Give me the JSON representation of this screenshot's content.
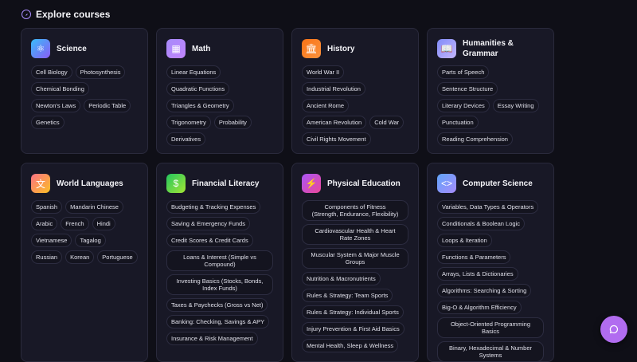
{
  "header": {
    "title": "Explore courses",
    "icon": "compass-icon"
  },
  "courses": [
    {
      "title": "Science",
      "icon": "atom-icon",
      "topics": [
        "Cell Biology",
        "Photosynthesis",
        "Chemical Bonding",
        "Newton's Laws",
        "Periodic Table",
        "Genetics"
      ]
    },
    {
      "title": "Math",
      "icon": "calculator-icon",
      "topics": [
        "Linear Equations",
        "Quadratic Functions",
        "Triangles & Geometry",
        "Trigonometry",
        "Probability",
        "Derivatives"
      ]
    },
    {
      "title": "History",
      "icon": "landmark-icon",
      "topics": [
        "World War II",
        "Industrial Revolution",
        "Ancient Rome",
        "American Revolution",
        "Cold War",
        "Civil Rights Movement"
      ]
    },
    {
      "title": "Humanities & Grammar",
      "icon": "book-icon",
      "topics": [
        "Parts of Speech",
        "Sentence Structure",
        "Literary Devices",
        "Essay Writing",
        "Punctuation",
        "Reading Comprehension"
      ]
    },
    {
      "title": "World Languages",
      "icon": "translate-icon",
      "topics": [
        "Spanish",
        "Mandarin Chinese",
        "Arabic",
        "French",
        "Hindi",
        "Vietnamese",
        "Tagalog",
        "Russian",
        "Korean",
        "Portuguese"
      ]
    },
    {
      "title": "Financial Literacy",
      "icon": "dollar-icon",
      "topics": [
        "Budgeting & Tracking Expenses",
        "Saving & Emergency Funds",
        "Credit Scores & Credit Cards",
        "Loans & Interest (Simple vs Compound)",
        "Investing Basics (Stocks, Bonds, Index Funds)",
        "Taxes & Paychecks (Gross vs Net)",
        "Banking: Checking, Savings & APY",
        "Insurance & Risk Management"
      ]
    },
    {
      "title": "Physical Education",
      "icon": "dumbbell-icon",
      "topics": [
        "Components of Fitness (Strength, Endurance, Flexibility)",
        "Cardiovascular Health & Heart Rate Zones",
        "Muscular System & Major Muscle Groups",
        "Nutrition & Macronutrients",
        "Rules & Strategy: Team Sports",
        "Rules & Strategy: Individual Sports",
        "Injury Prevention & First Aid Basics",
        "Mental Health, Sleep & Wellness"
      ]
    },
    {
      "title": "Computer Science",
      "icon": "code-icon",
      "topics": [
        "Variables, Data Types & Operators",
        "Conditionals & Boolean Logic",
        "Loops & Iteration",
        "Functions & Parameters",
        "Arrays, Lists & Dictionaries",
        "Algorithms: Searching & Sorting",
        "Big-O & Algorithm Efficiency",
        "Object-Oriented Programming Basics",
        "Binary, Hexadecimal & Number Systems"
      ]
    }
  ],
  "chat": {
    "icon": "chat-icon"
  }
}
